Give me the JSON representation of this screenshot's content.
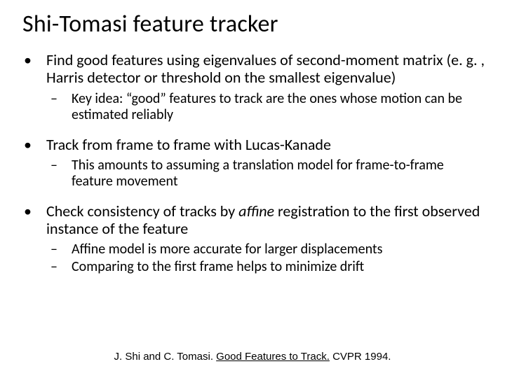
{
  "title": "Shi-Tomasi feature tracker",
  "points": [
    {
      "text": "Find good features using eigenvalues of second-moment matrix (e. g. , Harris detector or threshold on the smallest eigenvalue)",
      "sub": [
        "Key idea: “good” features to track are the ones whose motion can be estimated reliably"
      ]
    },
    {
      "text": "Track from frame to frame with Lucas-Kanade",
      "sub": [
        "This amounts to assuming a translation model for frame-to-frame feature movement"
      ]
    },
    {
      "text_html": "Check consistency of tracks by <span class=\"italic\">affine</span> registration to the first observed instance of the feature",
      "sub": [
        "Affine model is more accurate for larger displacements",
        "Comparing to the first frame helps to minimize drift"
      ]
    }
  ],
  "citation": {
    "prefix": "J. Shi and C. Tomasi. ",
    "link": "Good Features to Track.",
    "suffix": " CVPR 1994."
  }
}
